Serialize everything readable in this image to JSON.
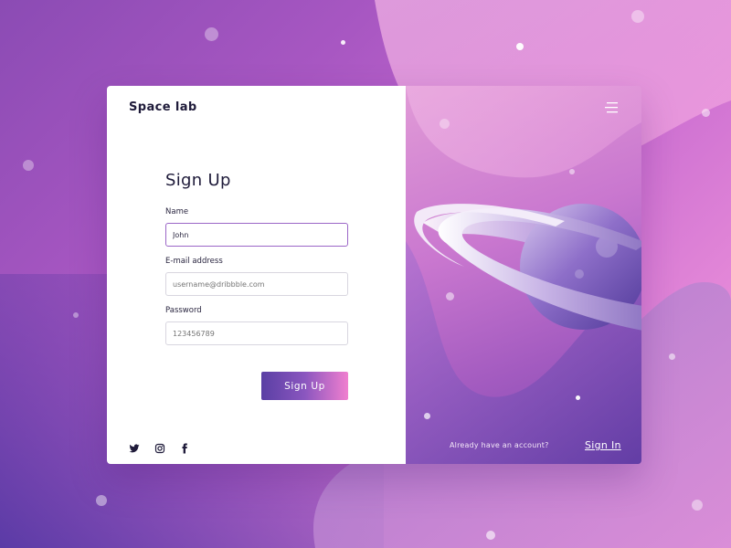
{
  "app": {
    "logo": "Space lab"
  },
  "form": {
    "title": "Sign Up",
    "name_label": "Name",
    "name_value": "John",
    "email_label": "E-mail address",
    "email_placeholder": "username@dribbble.com",
    "password_label": "Password",
    "password_placeholder": "123456789",
    "submit_label": "Sign Up"
  },
  "social": {
    "icons": [
      "twitter-icon",
      "instagram-icon",
      "facebook-icon"
    ]
  },
  "right_panel": {
    "menu_icon": "hamburger-menu-icon",
    "account_prompt": "Already have an account?",
    "signin_label": "Sign In"
  },
  "colors": {
    "accent_start": "#5a3fa4",
    "accent_end": "#f07fcf",
    "text_dark": "#1f1b3a"
  }
}
